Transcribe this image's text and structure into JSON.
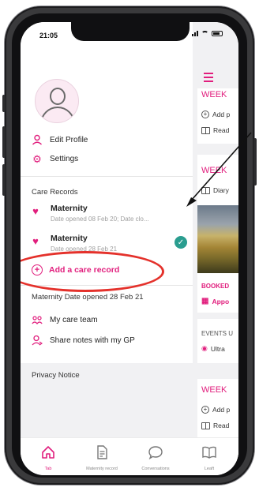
{
  "status": {
    "time": "21:05"
  },
  "drawer": {
    "edit_profile": "Edit Profile",
    "settings": "Settings",
    "care_records_title": "Care Records",
    "records": [
      {
        "name": "Maternity",
        "meta": "Date opened 08 Feb 20; Date clo..."
      },
      {
        "name": "Maternity",
        "meta": "Date opened 28 Feb 21"
      }
    ],
    "add_care_record": "Add a care record",
    "current_record_title": "Maternity Date opened 28 Feb 21",
    "my_care_team": "My care team",
    "share_notes": "Share notes with my GP",
    "privacy_notice": "Privacy Notice"
  },
  "content": {
    "week_1": "WEEK",
    "add_1": "Add p",
    "read_1": "Read",
    "week_2": "WEEK",
    "diary": "Diary",
    "booked": "BOOKED",
    "appointment": "Appo",
    "events": "EVENTS U",
    "ultrasound": "Ultra",
    "week_3": "WEEK",
    "add_3": "Add p",
    "read_3": "Read"
  },
  "tabs": [
    {
      "label": "Tab",
      "icon": "home-icon",
      "active": true
    },
    {
      "label": "Maternity record",
      "icon": "document-icon",
      "active": false
    },
    {
      "label": "Conversations",
      "icon": "chat-bubble-icon",
      "active": false
    },
    {
      "label": "Leaft",
      "icon": "book-icon",
      "active": false
    }
  ],
  "colors": {
    "accent": "#e11e7d",
    "check": "#2a9d8f",
    "annotation": "#e4312b"
  }
}
